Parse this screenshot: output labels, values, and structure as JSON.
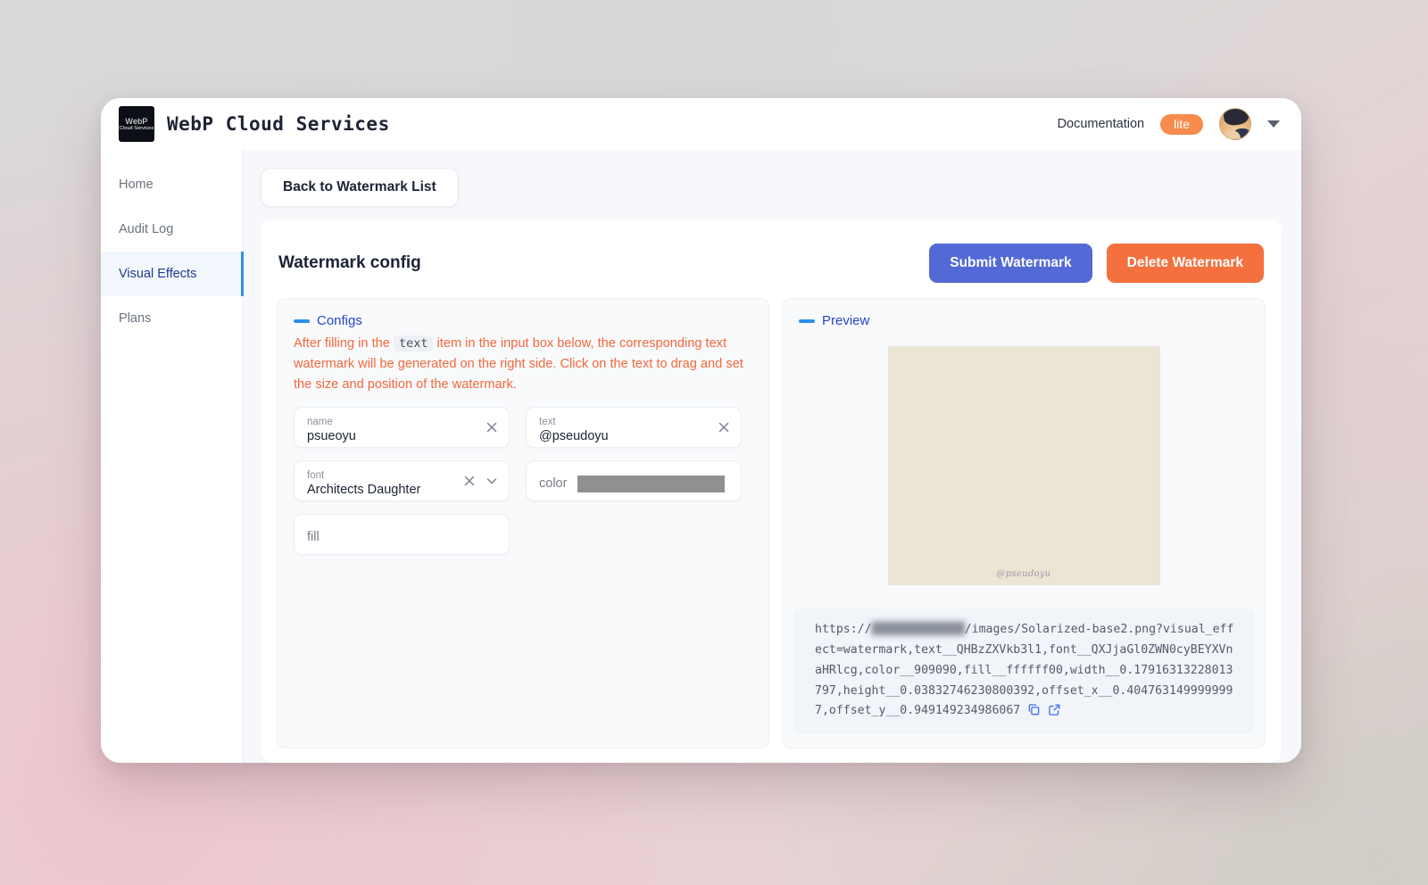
{
  "header": {
    "logo_line1": "WebP",
    "logo_line2": "Cloud Services",
    "title": "WebP Cloud Services",
    "documentation_label": "Documentation",
    "plan_badge": "lite",
    "accent_orange": "#f68b4b"
  },
  "sidebar": {
    "items": [
      {
        "label": "Home",
        "active": false
      },
      {
        "label": "Audit Log",
        "active": false
      },
      {
        "label": "Visual Effects",
        "active": true
      },
      {
        "label": "Plans",
        "active": false
      }
    ],
    "active_accent": "#2f8fe8"
  },
  "content": {
    "back_button": "Back to Watermark List",
    "card_title": "Watermark config",
    "submit_button": "Submit Watermark",
    "delete_button": "Delete Watermark",
    "submit_color": "#5269d6",
    "delete_color": "#f4713f"
  },
  "configs": {
    "section_label": "Configs",
    "hint_part1": "After filling in the",
    "hint_code": "text",
    "hint_part2": "item in the input box below, the corresponding text watermark will be generated on the right side. Click on the text to drag and set the size and position of the watermark.",
    "hint_color": "#f4673a",
    "fields": {
      "name": {
        "label": "name",
        "value": "psueoyu"
      },
      "text": {
        "label": "text",
        "value": "@pseudoyu"
      },
      "font": {
        "label": "font",
        "value": "Architects Daughter"
      },
      "color": {
        "label": "color",
        "value": "#909090"
      },
      "fill": {
        "label": "fill",
        "value": ""
      }
    }
  },
  "preview": {
    "section_label": "Preview",
    "image_background": "#ece5d4",
    "watermark_text": "@pseudoyu",
    "url_prefix": "https://",
    "url_domain_redacted": "██████████████",
    "url_rest": "/images/Solarized-base2.png?visual_effect=watermark,text__QHBzZXVkb3l1,font__QXJjaGl0ZWN0cyBEYXVnaHRlcg,color__909090,fill__ffffff00,width__0.17916313228013797,height__0.03832746230800392,offset_x__0.4047631499999997,offset_y__0.949149234986067"
  }
}
